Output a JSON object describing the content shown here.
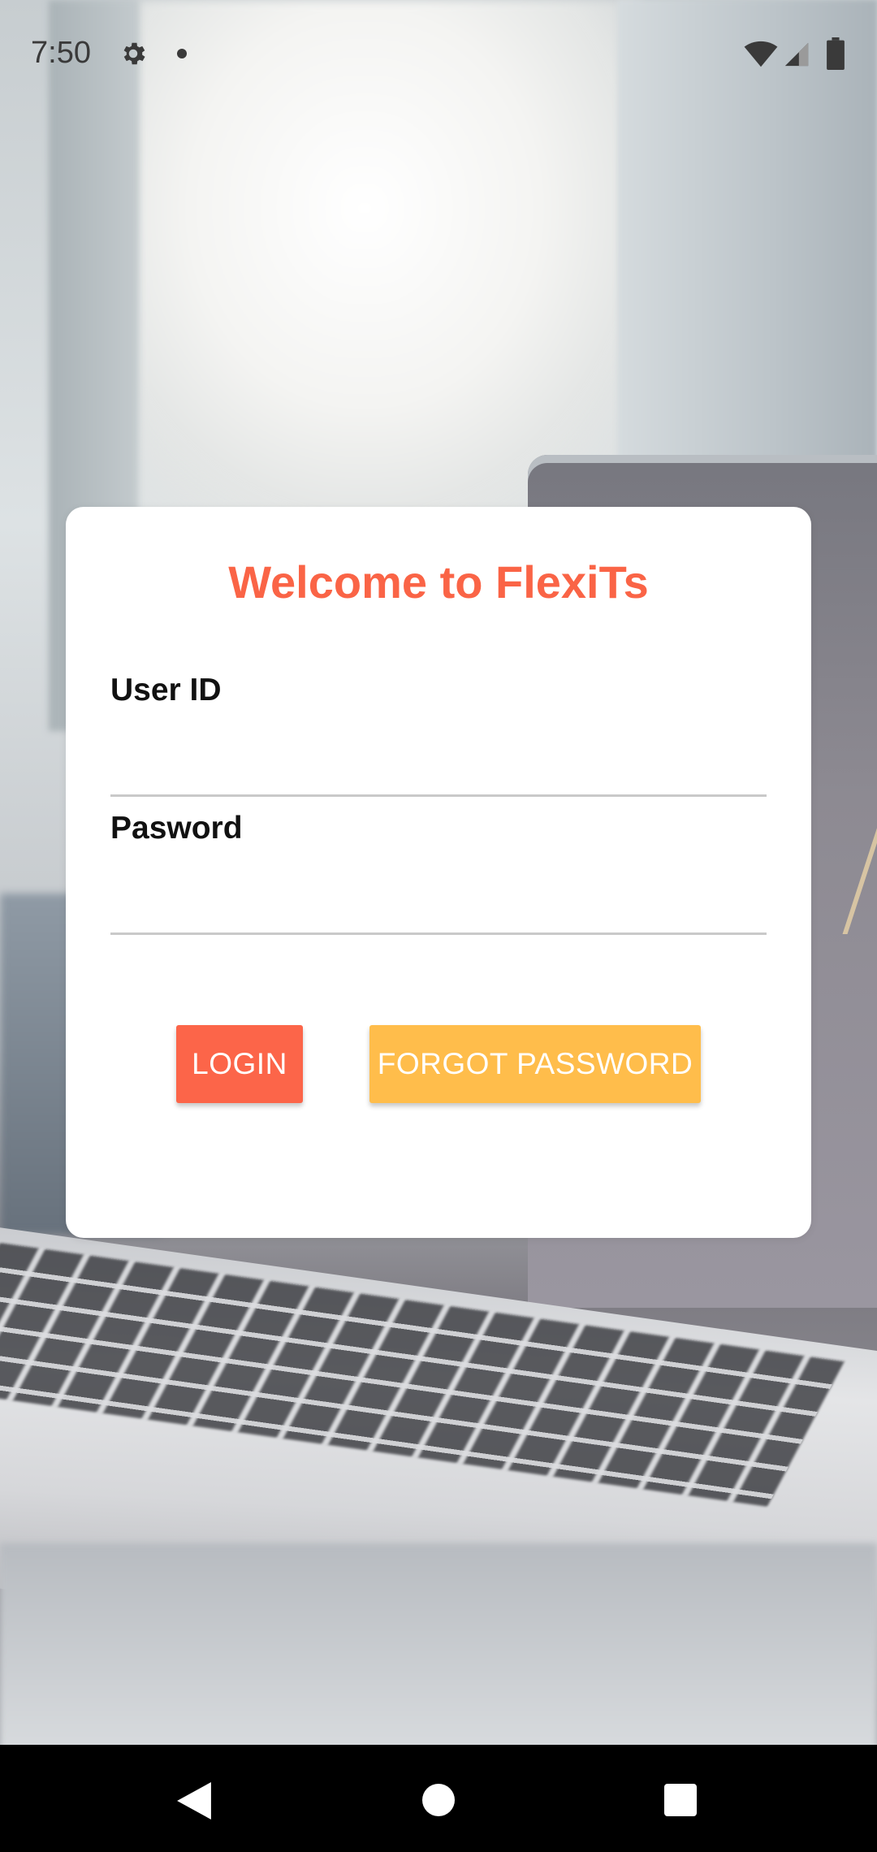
{
  "status_bar": {
    "time": "7:50",
    "icons": [
      "gear-icon",
      "notification-dot-icon",
      "wifi-icon",
      "cell-signal-icon",
      "battery-icon"
    ]
  },
  "login_card": {
    "title": "Welcome to FlexiTs",
    "user_id": {
      "label": "User ID",
      "value": "",
      "placeholder": ""
    },
    "password": {
      "label": "Pasword",
      "value": "",
      "placeholder": ""
    },
    "login_button": "LOGIN",
    "forgot_button": "FORGOT PASSWORD"
  },
  "nav_bar": {
    "icons": [
      "back-icon",
      "home-icon",
      "recents-icon"
    ]
  },
  "colors": {
    "title": "#fa6446",
    "login_button": "#fc6549",
    "forgot_button": "#ffbd4b",
    "card_background": "#ffffff",
    "nav_bar_background": "#000000"
  }
}
